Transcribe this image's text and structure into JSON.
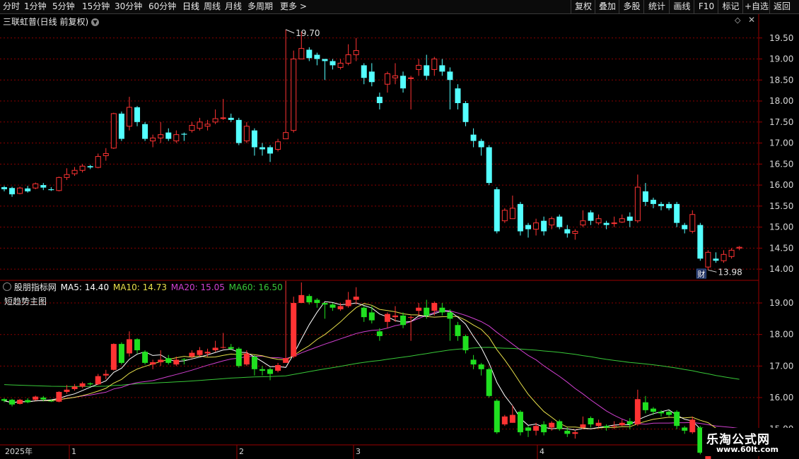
{
  "toolbar": {
    "periods": [
      "分时",
      "1分钟",
      "5分钟",
      "15分钟",
      "30分钟",
      "60分钟",
      "日线",
      "周线",
      "月线",
      "多周期",
      "更多 >"
    ],
    "active_period": "日线",
    "right_buttons": [
      "复权",
      "叠加",
      "多股",
      "统计",
      "画线",
      "F10",
      "标记",
      "+自选",
      "返回"
    ]
  },
  "top_panel": {
    "title": "三联虹普(日线 前复权)",
    "high_label": "19.70",
    "low_label": "13.98",
    "finance_badge": "财"
  },
  "bottom_panel": {
    "name": "股朋指标网",
    "ma5": "MA5: 14.40",
    "ma10": "MA10: 14.73",
    "ma20": "MA20: 15.05",
    "ma60": "MA60: 16.50",
    "subtitle": "短趋势主图"
  },
  "x_axis": {
    "labels": [
      "2025年",
      "1",
      "2",
      "3",
      "4"
    ]
  },
  "watermark": {
    "line1": "乐淘公式网",
    "line2": "www.60lt.com"
  },
  "colors": {
    "up": "#ff3333",
    "down_top": "#54ffff",
    "down_bottom": "#20e020",
    "ma5": "#ffffff",
    "ma10": "#e8e04a",
    "ma20": "#d040d0",
    "ma60": "#38c838",
    "grid": "#8a0000"
  },
  "chart_data": [
    {
      "type": "candlestick",
      "title": "三联虹普(日线 前复权)",
      "ylim": [
        13.75,
        20.0
      ],
      "yticks": [
        14.0,
        14.5,
        15.0,
        15.5,
        16.0,
        16.5,
        17.0,
        17.5,
        18.0,
        18.5,
        19.0,
        19.5
      ],
      "max_label": 19.7,
      "min_label": 13.98,
      "candles": [
        [
          15.95,
          15.9,
          15.98,
          15.85
        ],
        [
          15.93,
          15.78,
          15.96,
          15.72
        ],
        [
          15.8,
          15.93,
          15.96,
          15.78
        ],
        [
          15.92,
          15.85,
          15.98,
          15.82
        ],
        [
          15.93,
          16.03,
          16.06,
          15.9
        ],
        [
          16.0,
          15.94,
          16.05,
          15.88
        ],
        [
          15.9,
          15.88,
          15.95,
          15.86
        ],
        [
          15.87,
          16.18,
          16.2,
          15.85
        ],
        [
          16.18,
          16.25,
          16.4,
          16.12
        ],
        [
          16.27,
          16.35,
          16.43,
          16.22
        ],
        [
          16.35,
          16.45,
          16.5,
          16.3
        ],
        [
          16.45,
          16.42,
          16.48,
          16.38
        ],
        [
          16.42,
          16.68,
          16.75,
          16.4
        ],
        [
          16.7,
          16.75,
          16.88,
          16.58
        ],
        [
          16.88,
          17.7,
          17.72,
          16.86
        ],
        [
          17.7,
          17.1,
          17.75,
          17.05
        ],
        [
          17.4,
          17.85,
          18.1,
          17.3
        ],
        [
          17.85,
          17.5,
          17.88,
          17.4
        ],
        [
          17.45,
          17.1,
          17.5,
          17.05
        ],
        [
          17.05,
          17.12,
          17.2,
          16.9
        ],
        [
          17.12,
          17.2,
          17.5,
          17.0
        ],
        [
          17.25,
          17.1,
          17.35,
          17.05
        ],
        [
          17.05,
          17.2,
          17.3,
          17.0
        ],
        [
          17.22,
          17.2,
          17.25,
          17.05
        ],
        [
          17.3,
          17.42,
          17.5,
          17.25
        ],
        [
          17.35,
          17.5,
          17.6,
          17.3
        ],
        [
          17.4,
          17.45,
          17.55,
          17.3
        ],
        [
          17.5,
          17.58,
          17.8,
          17.45
        ],
        [
          17.6,
          17.6,
          18.05,
          17.55
        ],
        [
          17.6,
          17.55,
          17.7,
          17.5
        ],
        [
          17.55,
          17.0,
          17.6,
          16.95
        ],
        [
          17.05,
          17.4,
          17.5,
          17.0
        ],
        [
          17.3,
          16.9,
          17.35,
          16.7
        ],
        [
          16.9,
          16.85,
          17.0,
          16.7
        ],
        [
          16.9,
          16.75,
          16.95,
          16.55
        ],
        [
          16.85,
          17.03,
          17.1,
          16.8
        ],
        [
          17.1,
          17.25,
          19.7,
          17.15
        ],
        [
          17.3,
          19.0,
          19.2,
          17.25
        ],
        [
          19.0,
          19.25,
          19.65,
          19.0
        ],
        [
          19.22,
          19.02,
          19.28,
          18.95
        ],
        [
          19.1,
          19.0,
          19.15,
          18.85
        ],
        [
          19.0,
          18.95,
          19.0,
          18.5
        ],
        [
          18.95,
          18.85,
          19.0,
          18.75
        ],
        [
          18.8,
          18.9,
          19.0,
          18.75
        ],
        [
          18.9,
          19.1,
          19.35,
          18.85
        ],
        [
          19.1,
          19.2,
          19.5,
          18.95
        ],
        [
          18.85,
          18.55,
          18.9,
          18.4
        ],
        [
          18.7,
          18.45,
          18.9,
          18.35
        ],
        [
          18.1,
          17.95,
          18.2,
          17.8
        ],
        [
          18.4,
          18.65,
          18.7,
          18.2
        ],
        [
          18.55,
          18.6,
          18.9,
          18.4
        ],
        [
          18.6,
          18.3,
          18.7,
          18.2
        ],
        [
          18.55,
          18.55,
          18.6,
          17.8
        ],
        [
          18.75,
          18.85,
          19.0,
          18.6
        ],
        [
          18.85,
          18.6,
          19.1,
          18.5
        ],
        [
          18.75,
          19.0,
          19.05,
          18.6
        ],
        [
          18.85,
          18.7,
          19.0,
          18.6
        ],
        [
          18.7,
          18.5,
          18.8,
          17.8
        ],
        [
          18.3,
          17.95,
          18.4,
          17.8
        ],
        [
          17.95,
          17.5,
          18.0,
          17.4
        ],
        [
          17.2,
          17.05,
          17.35,
          16.9
        ],
        [
          17.05,
          16.9,
          17.1,
          16.7
        ],
        [
          16.9,
          16.05,
          16.95,
          16.0
        ],
        [
          15.9,
          14.9,
          15.95,
          14.85
        ],
        [
          15.15,
          15.4,
          15.45,
          15.1
        ],
        [
          15.2,
          15.45,
          15.75,
          15.2
        ],
        [
          15.55,
          14.9,
          15.6,
          14.8
        ],
        [
          15.05,
          14.95,
          15.1,
          14.75
        ],
        [
          14.95,
          15.1,
          15.2,
          14.8
        ],
        [
          15.15,
          14.9,
          15.25,
          14.8
        ],
        [
          15.05,
          15.2,
          15.25,
          14.95
        ],
        [
          15.25,
          15.0,
          15.3,
          14.95
        ],
        [
          14.95,
          14.85,
          15.05,
          14.75
        ],
        [
          14.85,
          14.9,
          14.95,
          14.7
        ],
        [
          15.05,
          15.15,
          15.4,
          15.0
        ],
        [
          15.35,
          15.15,
          15.4,
          15.05
        ],
        [
          15.1,
          15.2,
          15.3,
          15.05
        ],
        [
          15.1,
          15.05,
          15.15,
          14.95
        ],
        [
          15.1,
          15.1,
          15.25,
          15.0
        ],
        [
          15.12,
          15.2,
          15.3,
          15.1
        ],
        [
          15.25,
          15.15,
          15.35,
          15.0
        ],
        [
          15.15,
          15.95,
          16.25,
          15.1
        ],
        [
          15.85,
          15.6,
          16.05,
          15.5
        ],
        [
          15.65,
          15.55,
          15.7,
          15.45
        ],
        [
          15.55,
          15.5,
          15.6,
          15.4
        ],
        [
          15.55,
          15.45,
          15.6,
          15.4
        ],
        [
          15.55,
          15.1,
          15.6,
          15.0
        ],
        [
          15.05,
          14.95,
          15.1,
          14.85
        ],
        [
          14.9,
          15.3,
          15.4,
          14.85
        ],
        [
          15.05,
          14.25,
          15.1,
          14.2
        ],
        [
          14.05,
          14.4,
          14.45,
          13.98
        ],
        [
          14.25,
          14.2,
          14.4,
          14.15
        ],
        [
          14.2,
          14.35,
          14.45,
          14.15
        ],
        [
          14.3,
          14.45,
          14.5,
          14.25
        ],
        [
          14.5,
          14.52,
          14.55,
          14.45
        ]
      ]
    },
    {
      "type": "candlestick",
      "title": "短趋势主图",
      "ylim": [
        14.5,
        19.65
      ],
      "yticks": [
        15.0,
        16.0,
        17.0,
        18.0,
        19.0
      ],
      "series_names": [
        "MA5",
        "MA10",
        "MA20",
        "MA60"
      ],
      "legend_values": {
        "MA5": 14.4,
        "MA10": 14.73,
        "MA20": 15.05,
        "MA60": 16.5
      }
    }
  ]
}
